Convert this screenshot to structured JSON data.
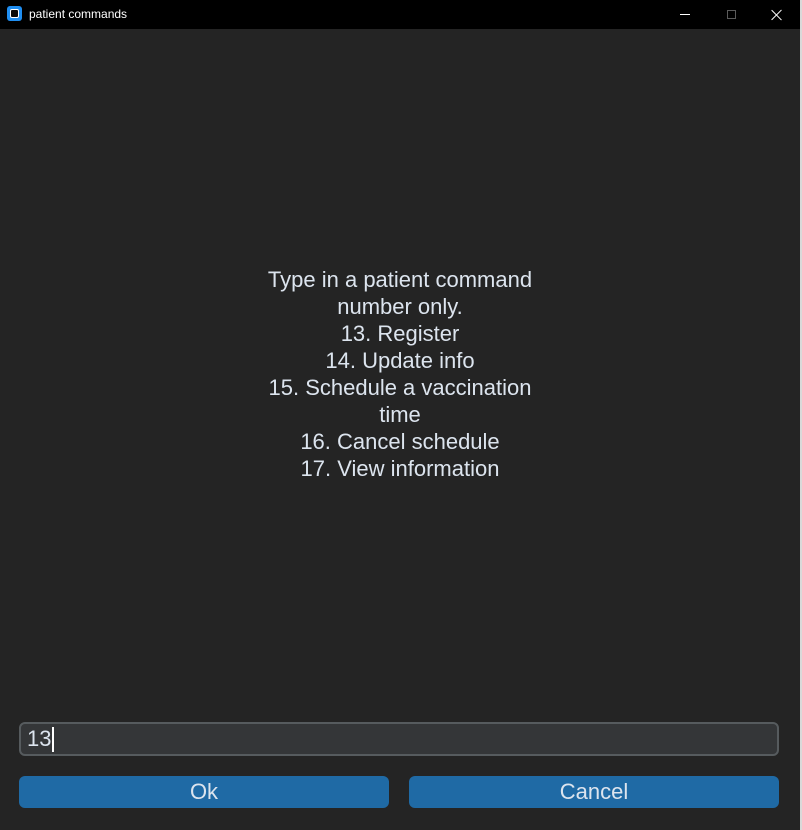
{
  "window": {
    "title": "patient commands",
    "icon": "app-icon",
    "controls": [
      "minimize-icon",
      "maximize-icon",
      "close-icon"
    ]
  },
  "message": {
    "lines": [
      "Type in a patient command",
      "number only.",
      "13. Register",
      "14. Update info",
      "15. Schedule a vaccination",
      "time",
      "16. Cancel schedule",
      "17. View information"
    ]
  },
  "input": {
    "value": "13"
  },
  "buttons": {
    "ok_label": "Ok",
    "cancel_label": "Cancel"
  },
  "colors": {
    "background": "#242424",
    "titlebar": "#000000",
    "button": "#1f6aa5",
    "entry_bg": "#343638",
    "entry_border": "#565b5e",
    "text": "#dce4ee"
  }
}
